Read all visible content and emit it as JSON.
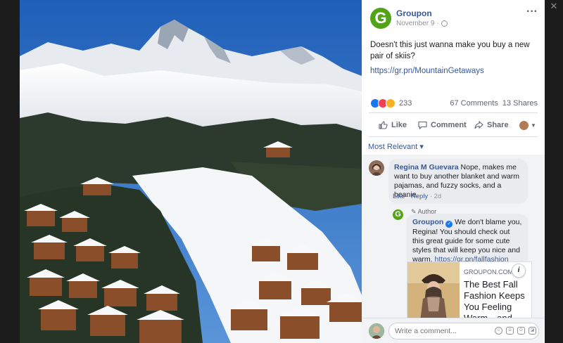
{
  "post": {
    "page_name": "Groupon",
    "page_initial": "G",
    "date": "November 9",
    "separator": "·",
    "text": "Doesn't this just wanna make you buy a new pair of skiis?",
    "link": "https://gr.pn/MountainGetaways"
  },
  "stats": {
    "reaction_count": "233",
    "comments": "67 Comments",
    "shares": "13 Shares"
  },
  "actions": {
    "like": "Like",
    "comment": "Comment",
    "share": "Share"
  },
  "sort_label": "Most Relevant ▾",
  "comments": [
    {
      "author": "Regina M Guevara",
      "text": "Nope, makes me want to buy another blanket and warm pajamas, and fuzzy socks, and a beanie.",
      "like": "Like",
      "reply": "Reply",
      "time": "2d"
    },
    {
      "badge": "Author",
      "author": "Groupon",
      "text": "We don't blame you, Regina! You should check out this great guide for some cute styles that will keep you nice and warm.",
      "link": "https://gr.pn/fallfashion",
      "card_domain": "GROUPON.COM",
      "card_title": "The Best Fall Fashion Keeps You Feeling Warm—and"
    }
  ],
  "composer": {
    "placeholder": "Write a comment..."
  },
  "colors": {
    "link_blue": "#385898",
    "brand_green": "#53a318",
    "panel_bg": "#ffffff",
    "comments_bg": "#f2f3f5"
  },
  "icons": [
    "close-icon",
    "more-icon",
    "globe-icon",
    "like-icon",
    "comment-icon",
    "share-icon",
    "verified-icon",
    "info-icon",
    "emoji-icon",
    "gif-icon",
    "sticker-icon"
  ]
}
